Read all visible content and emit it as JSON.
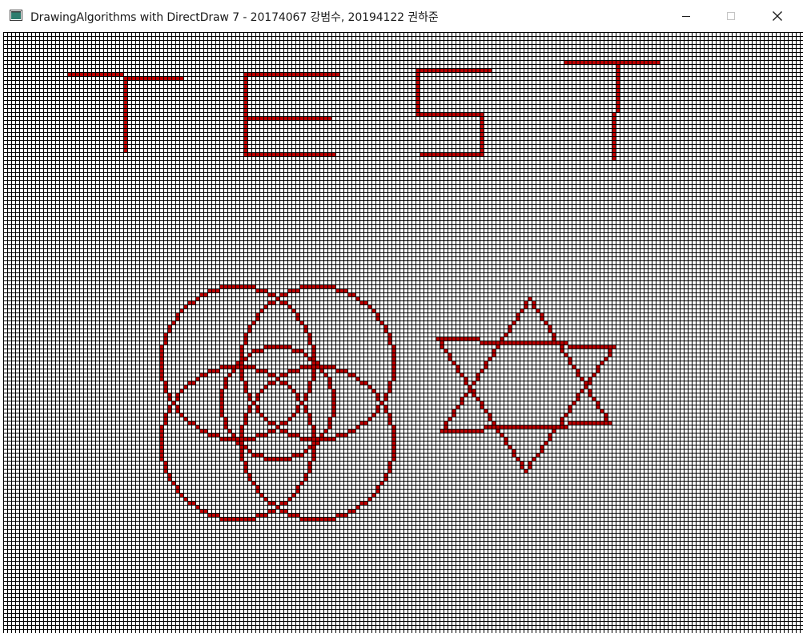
{
  "window": {
    "title": "DrawingAlgorithms with DirectDraw 7 - 20174067 강범수, 20194122 권하준",
    "app_icon": "window-app-icon",
    "controls": [
      "minimize-icon",
      "maximize-icon",
      "close-icon"
    ]
  },
  "canvas": {
    "grid_color": "#000000",
    "pixel_color": "#c00000",
    "background": "#ffffff",
    "letters": [
      "T",
      "E",
      "S",
      "T"
    ]
  }
}
